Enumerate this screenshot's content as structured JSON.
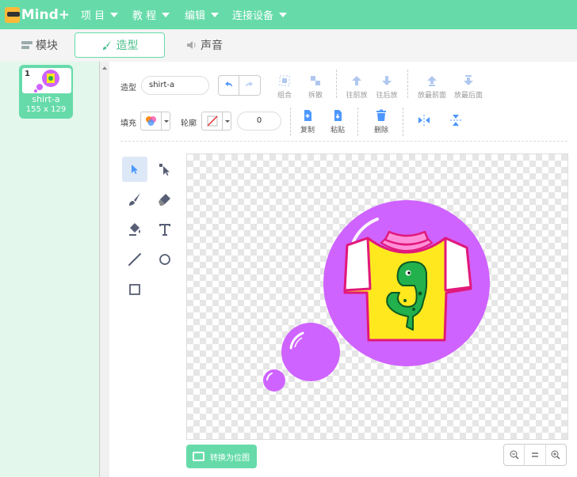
{
  "app": {
    "logo_text": "Mind+",
    "menu": [
      {
        "label": "项 目"
      },
      {
        "label": "教 程"
      },
      {
        "label": "编辑"
      },
      {
        "label": "连接设备"
      }
    ]
  },
  "tabs": [
    {
      "label": "模块",
      "icon": "blocks-icon"
    },
    {
      "label": "造型",
      "icon": "brush-icon",
      "active": true
    },
    {
      "label": "声音",
      "icon": "speaker-icon"
    }
  ],
  "costumes": [
    {
      "number": "1",
      "name": "shirt-a",
      "size": "155 x 129",
      "selected": true
    }
  ],
  "toolbar": {
    "costume_label": "造型",
    "costume_name": "shirt-a",
    "group_label": "组合",
    "ungroup_label": "拆散",
    "forward_label": "往前放",
    "backward_label": "往后放",
    "front_label": "放最前面",
    "back_label": "放最后面",
    "fill_label": "填充",
    "outline_label": "轮廓",
    "outline_width": "0",
    "copy_label": "复制",
    "paste_label": "粘贴",
    "delete_label": "删除"
  },
  "canvas": {
    "convert_label": "转换为位图"
  },
  "colors": {
    "accent": "#66dba9",
    "purple": "#cf63ff",
    "shirt_yellow": "#ffe81e",
    "dino_green": "#22b14c"
  }
}
